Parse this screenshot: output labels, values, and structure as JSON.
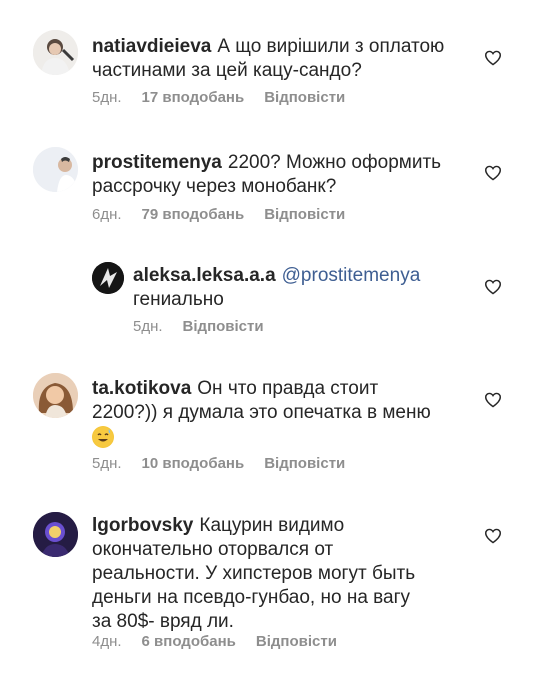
{
  "comments": [
    {
      "username": "natiavdieieva",
      "text_lines": [
        "А що вирішили з оплатою",
        "частинами за цей кацу-сандо?"
      ],
      "time": "5дн.",
      "likes": "17 вподобань",
      "reply": "Відповісти"
    },
    {
      "username": "prostitemenya",
      "text_lines": [
        "2200? Можно оформить",
        "рассрочку через монобанк?"
      ],
      "time": "6дн.",
      "likes": "79 вподобань",
      "reply": "Відповісти"
    },
    {
      "username": "aleksa.leksa.a.a",
      "mention": "@prostitemenya",
      "text_lines": [
        "гениально"
      ],
      "time": "5дн.",
      "reply": "Відповісти"
    },
    {
      "username": "ta.kotikova",
      "text_lines": [
        "Он что правда стоит",
        "2200?)) я думала это опечатка в меню"
      ],
      "emoji": "😅",
      "time": "5дн.",
      "likes": "10 вподобань",
      "reply": "Відповісти"
    },
    {
      "username": "lgorbovsky",
      "text_lines": [
        "Кацурин видимо",
        "окончательно оторвался от",
        "реальности. У хипстеров могут быть",
        "деньги на псевдо-гунбао, но на вагу",
        "за 80$- вряд ли."
      ],
      "time": "4дн.",
      "likes": "6 вподобань",
      "reply": "Відповісти"
    }
  ],
  "icons": {
    "like": "heart-outline-icon"
  },
  "colors": {
    "text": "#262626",
    "meta": "#8e8e8e",
    "mention": "#3e5e92"
  }
}
